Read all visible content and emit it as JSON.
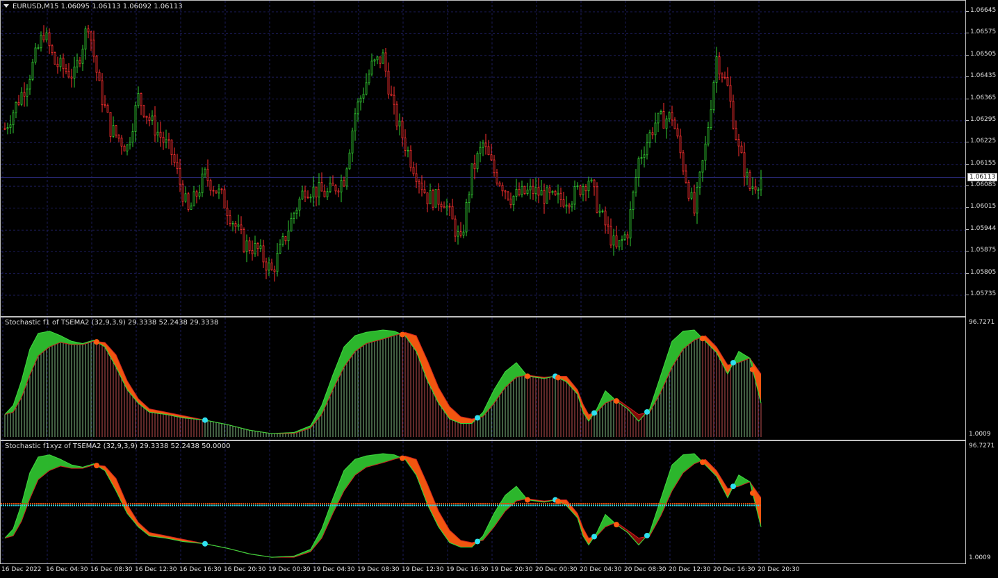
{
  "main_chart": {
    "title": "EURUSD,M15  1.06095 1.06113 1.06092 1.06113",
    "current_price": "1.06113",
    "price_labels": [
      "1.06645",
      "1.06575",
      "1.06505",
      "1.06435",
      "1.06365",
      "1.06295",
      "1.06225",
      "1.06155",
      "1.06085",
      "1.06015",
      "1.05944",
      "1.05875",
      "1.05805",
      "1.05735"
    ],
    "colors": {
      "bull": "#32cd32",
      "bear": "#ff3030",
      "grid": "#1c1c5a",
      "current_line": "#26266e"
    }
  },
  "indicator1": {
    "title": "Stochastic f1 of TSEMA2 (32,9,3,9) 29.3338 52.2438 29.3338",
    "max_label": "96.7271",
    "min_label": "1.0009"
  },
  "indicator2": {
    "title": "Stochastic f1xyz of TSEMA2 (32,9,3,9) 29.3338 52.2438 50.0000",
    "max_label": "96.7271",
    "min_label": "1.0009"
  },
  "time_axis": {
    "labels": [
      "16 Dec 2022",
      "16 Dec 04:30",
      "16 Dec 08:30",
      "16 Dec 12:30",
      "16 Dec 16:30",
      "16 Dec 20:30",
      "19 Dec 00:30",
      "19 Dec 04:30",
      "19 Dec 08:30",
      "19 Dec 12:30",
      "19 Dec 16:30",
      "19 Dec 20:30",
      "20 Dec 00:30",
      "20 Dec 04:30",
      "20 Dec 08:30",
      "20 Dec 12:30",
      "20 Dec 16:30",
      "20 Dec 20:30"
    ]
  },
  "chart_data": {
    "type": "candlestick",
    "symbol": "EURUSD",
    "timeframe": "M15",
    "last_ohlc": {
      "open": 1.06095,
      "high": 1.06113,
      "low": 1.06092,
      "close": 1.06113
    },
    "ylim": [
      1.05735,
      1.0668
    ],
    "close_path": [
      [
        0,
        1.0627
      ],
      [
        8,
        1.0642
      ],
      [
        14,
        1.0658
      ],
      [
        18,
        1.0648
      ],
      [
        25,
        1.0644
      ],
      [
        30,
        1.0661
      ],
      [
        34,
        1.064
      ],
      [
        38,
        1.0627
      ],
      [
        44,
        1.0621
      ],
      [
        48,
        1.0637
      ],
      [
        52,
        1.063
      ],
      [
        60,
        1.0619
      ],
      [
        66,
        1.06
      ],
      [
        72,
        1.0612
      ],
      [
        78,
        1.0605
      ],
      [
        86,
        1.059
      ],
      [
        91,
        1.0588
      ],
      [
        96,
        1.0581
      ],
      [
        100,
        1.059
      ],
      [
        104,
        1.06
      ],
      [
        108,
        1.0608
      ],
      [
        116,
        1.0606
      ],
      [
        122,
        1.0611
      ],
      [
        126,
        1.0632
      ],
      [
        132,
        1.0647
      ],
      [
        136,
        1.065
      ],
      [
        140,
        1.0632
      ],
      [
        146,
        1.0617
      ],
      [
        152,
        1.0605
      ],
      [
        158,
        1.0604
      ],
      [
        164,
        1.059
      ],
      [
        168,
        1.0613
      ],
      [
        172,
        1.0622
      ],
      [
        176,
        1.0613
      ],
      [
        182,
        1.0605
      ],
      [
        190,
        1.0607
      ],
      [
        198,
        1.0604
      ],
      [
        204,
        1.0605
      ],
      [
        210,
        1.0611
      ],
      [
        214,
        1.06
      ],
      [
        220,
        1.0588
      ],
      [
        224,
        1.0594
      ],
      [
        228,
        1.0617
      ],
      [
        234,
        1.0629
      ],
      [
        240,
        1.0631
      ],
      [
        244,
        1.0615
      ],
      [
        248,
        1.06
      ],
      [
        252,
        1.0621
      ],
      [
        256,
        1.065
      ],
      [
        260,
        1.064
      ],
      [
        264,
        1.062
      ],
      [
        268,
        1.0608
      ],
      [
        272,
        1.0611
      ]
    ],
    "indicators": [
      {
        "name": "Stochastic f1 of TSEMA2 (32,9,3,9)",
        "values": [
          29.3338,
          52.2438,
          29.3338
        ],
        "range": [
          1.0009,
          96.7271
        ]
      },
      {
        "name": "Stochastic f1xyz of TSEMA2 (32,9,3,9)",
        "values": [
          29.3338,
          52.2438,
          50.0
        ],
        "range": [
          1.0009,
          96.7271
        ]
      }
    ],
    "osc_main": [
      [
        0,
        20
      ],
      [
        3,
        28
      ],
      [
        6,
        50
      ],
      [
        9,
        78
      ],
      [
        12,
        92
      ],
      [
        16,
        94
      ],
      [
        20,
        90
      ],
      [
        24,
        85
      ],
      [
        28,
        83
      ],
      [
        32,
        86
      ],
      [
        36,
        80
      ],
      [
        40,
        62
      ],
      [
        44,
        42
      ],
      [
        48,
        30
      ],
      [
        52,
        22
      ],
      [
        58,
        20
      ],
      [
        64,
        17
      ],
      [
        72,
        15
      ],
      [
        80,
        11
      ],
      [
        88,
        6
      ],
      [
        96,
        3
      ],
      [
        104,
        4
      ],
      [
        110,
        10
      ],
      [
        114,
        28
      ],
      [
        118,
        55
      ],
      [
        122,
        80
      ],
      [
        126,
        90
      ],
      [
        130,
        93
      ],
      [
        136,
        95
      ],
      [
        140,
        94
      ],
      [
        144,
        90
      ],
      [
        148,
        76
      ],
      [
        152,
        50
      ],
      [
        156,
        30
      ],
      [
        160,
        16
      ],
      [
        164,
        12
      ],
      [
        168,
        12
      ],
      [
        172,
        22
      ],
      [
        176,
        42
      ],
      [
        180,
        58
      ],
      [
        184,
        66
      ],
      [
        188,
        54
      ],
      [
        194,
        52
      ],
      [
        198,
        54
      ],
      [
        202,
        49
      ],
      [
        206,
        38
      ],
      [
        208,
        22
      ],
      [
        210,
        14
      ],
      [
        213,
        25
      ],
      [
        216,
        41
      ],
      [
        220,
        32
      ],
      [
        224,
        25
      ],
      [
        228,
        14
      ],
      [
        232,
        25
      ],
      [
        236,
        55
      ],
      [
        240,
        85
      ],
      [
        244,
        94
      ],
      [
        248,
        95
      ],
      [
        252,
        85
      ],
      [
        256,
        75
      ],
      [
        260,
        56
      ],
      [
        264,
        76
      ],
      [
        268,
        70
      ],
      [
        272,
        30
      ]
    ],
    "osc_signal": [
      [
        0,
        20
      ],
      [
        3,
        22
      ],
      [
        6,
        35
      ],
      [
        9,
        55
      ],
      [
        12,
        72
      ],
      [
        16,
        80
      ],
      [
        20,
        84
      ],
      [
        24,
        82
      ],
      [
        28,
        82
      ],
      [
        32,
        85
      ],
      [
        36,
        84
      ],
      [
        40,
        73
      ],
      [
        44,
        50
      ],
      [
        48,
        34
      ],
      [
        52,
        25
      ],
      [
        58,
        22
      ],
      [
        64,
        19
      ],
      [
        72,
        15
      ],
      [
        80,
        11
      ],
      [
        88,
        6
      ],
      [
        96,
        3
      ],
      [
        104,
        3
      ],
      [
        110,
        8
      ],
      [
        114,
        20
      ],
      [
        118,
        42
      ],
      [
        122,
        62
      ],
      [
        126,
        76
      ],
      [
        130,
        83
      ],
      [
        136,
        87
      ],
      [
        140,
        90
      ],
      [
        144,
        93
      ],
      [
        148,
        90
      ],
      [
        152,
        68
      ],
      [
        156,
        44
      ],
      [
        160,
        27
      ],
      [
        164,
        18
      ],
      [
        168,
        16
      ],
      [
        172,
        18
      ],
      [
        176,
        30
      ],
      [
        180,
        44
      ],
      [
        184,
        53
      ],
      [
        188,
        55
      ],
      [
        194,
        53
      ],
      [
        198,
        54
      ],
      [
        202,
        54
      ],
      [
        206,
        42
      ],
      [
        208,
        29
      ],
      [
        210,
        20
      ],
      [
        213,
        22
      ],
      [
        216,
        30
      ],
      [
        220,
        34
      ],
      [
        224,
        27
      ],
      [
        228,
        20
      ],
      [
        232,
        22
      ],
      [
        236,
        40
      ],
      [
        240,
        62
      ],
      [
        244,
        78
      ],
      [
        248,
        86
      ],
      [
        252,
        90
      ],
      [
        256,
        80
      ],
      [
        260,
        64
      ],
      [
        264,
        66
      ],
      [
        268,
        70
      ],
      [
        272,
        56
      ]
    ],
    "level_line": 50
  }
}
